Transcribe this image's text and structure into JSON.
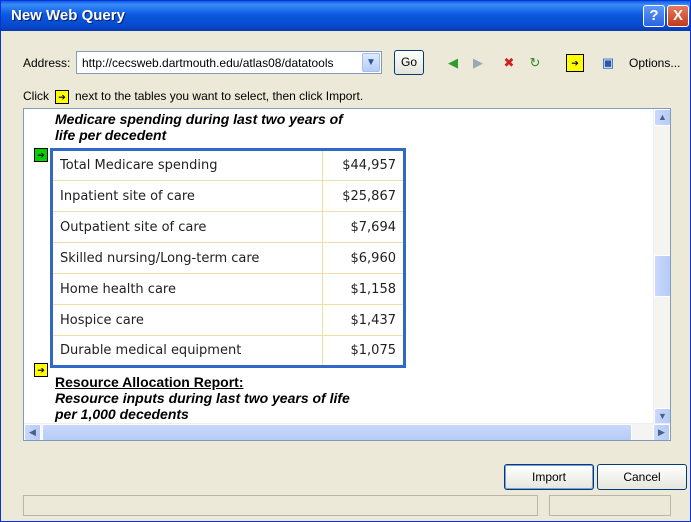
{
  "window": {
    "title": "New Web Query",
    "help_label": "?",
    "close_label": "X"
  },
  "toolbar": {
    "address_label": "Address:",
    "address_value": "http://cecsweb.dartmouth.edu/atlas08/datatools",
    "go_label": "Go",
    "options_label": "Options...",
    "icons": [
      "back-icon",
      "forward-icon",
      "stop-icon",
      "refresh-icon",
      "show-icons-icon",
      "save-query-icon"
    ]
  },
  "instruction": {
    "before": "Click",
    "after": "next to the tables you want to select, then click Import."
  },
  "content": {
    "section1_heading": "Medicare spending during last two years of life per decedent",
    "table_rows": [
      {
        "label": "Total Medicare spending",
        "value": "$44,957"
      },
      {
        "label": "Inpatient site of care",
        "value": "$25,867"
      },
      {
        "label": "Outpatient site of care",
        "value": "$7,694"
      },
      {
        "label": "Skilled nursing/Long-term care",
        "value": "$6,960"
      },
      {
        "label": "Home health care",
        "value": "$1,158"
      },
      {
        "label": "Hospice care",
        "value": "$1,437"
      },
      {
        "label": "Durable medical equipment",
        "value": "$1,075"
      }
    ],
    "section2_title": "Resource Allocation Report:",
    "section2_subtitle": "Resource inputs during last two years of life per 1,000 decedents"
  },
  "buttons": {
    "import_label": "Import",
    "cancel_label": "Cancel"
  },
  "colors": {
    "title_bar": "#0a5ae0",
    "table_border": "#3068c8",
    "selected_marker": "#00d000",
    "unselected_marker": "#ffff00"
  }
}
